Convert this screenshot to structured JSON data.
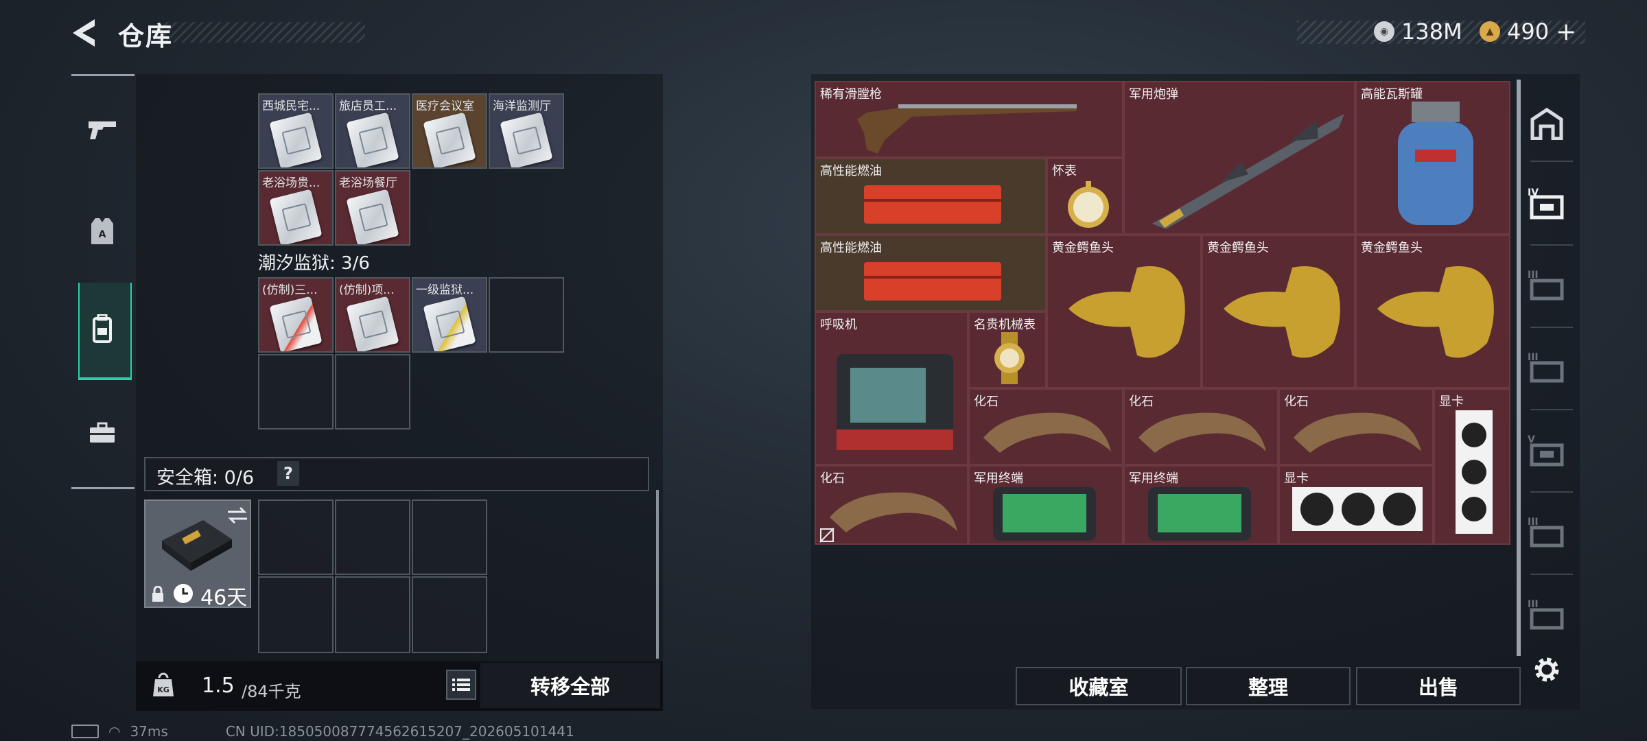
{
  "header": {
    "title": "仓库"
  },
  "currency": {
    "silver": "138M",
    "gold": "490",
    "gold_add": "+"
  },
  "left_panel": {
    "section2_label": "潮汐监狱: 3/6",
    "section1_items": [
      "西城民宅...",
      "旅店员工...",
      "医疗会议室",
      "海洋监测厅",
      "老浴场贵...",
      "老浴场餐厅"
    ],
    "section2_items": [
      "(仿制)三...",
      "(仿制)项...",
      "一级监狱..."
    ],
    "safebox_label": "安全箱: 0/6",
    "safebox_help": "?",
    "safebox_time": "46天",
    "weight_value": "1.5",
    "weight_max": "/84千克",
    "transfer_all": "转移全部"
  },
  "right_panel": {
    "items": [
      "稀有滑膛枪",
      "军用炮弹",
      "高能瓦斯罐",
      "高性能燃油",
      "怀表",
      "高性能燃油",
      "黄金鳄鱼头",
      "黄金鳄鱼头",
      "黄金鳄鱼头",
      "呼吸机",
      "名贵机械表",
      "化石",
      "化石",
      "化石",
      "显卡",
      "化石",
      "军用终端",
      "军用终端",
      "显卡"
    ],
    "buttons": {
      "collection": "收藏室",
      "organize": "整理",
      "sell": "出售"
    }
  },
  "footer": {
    "ping": "37ms",
    "uid": "CN UID:185050087774562615207_202605101441"
  },
  "colors": {
    "accent": "#2fd0a8",
    "item_red": "#5a2a32",
    "item_brown": "#4a3a2c"
  }
}
